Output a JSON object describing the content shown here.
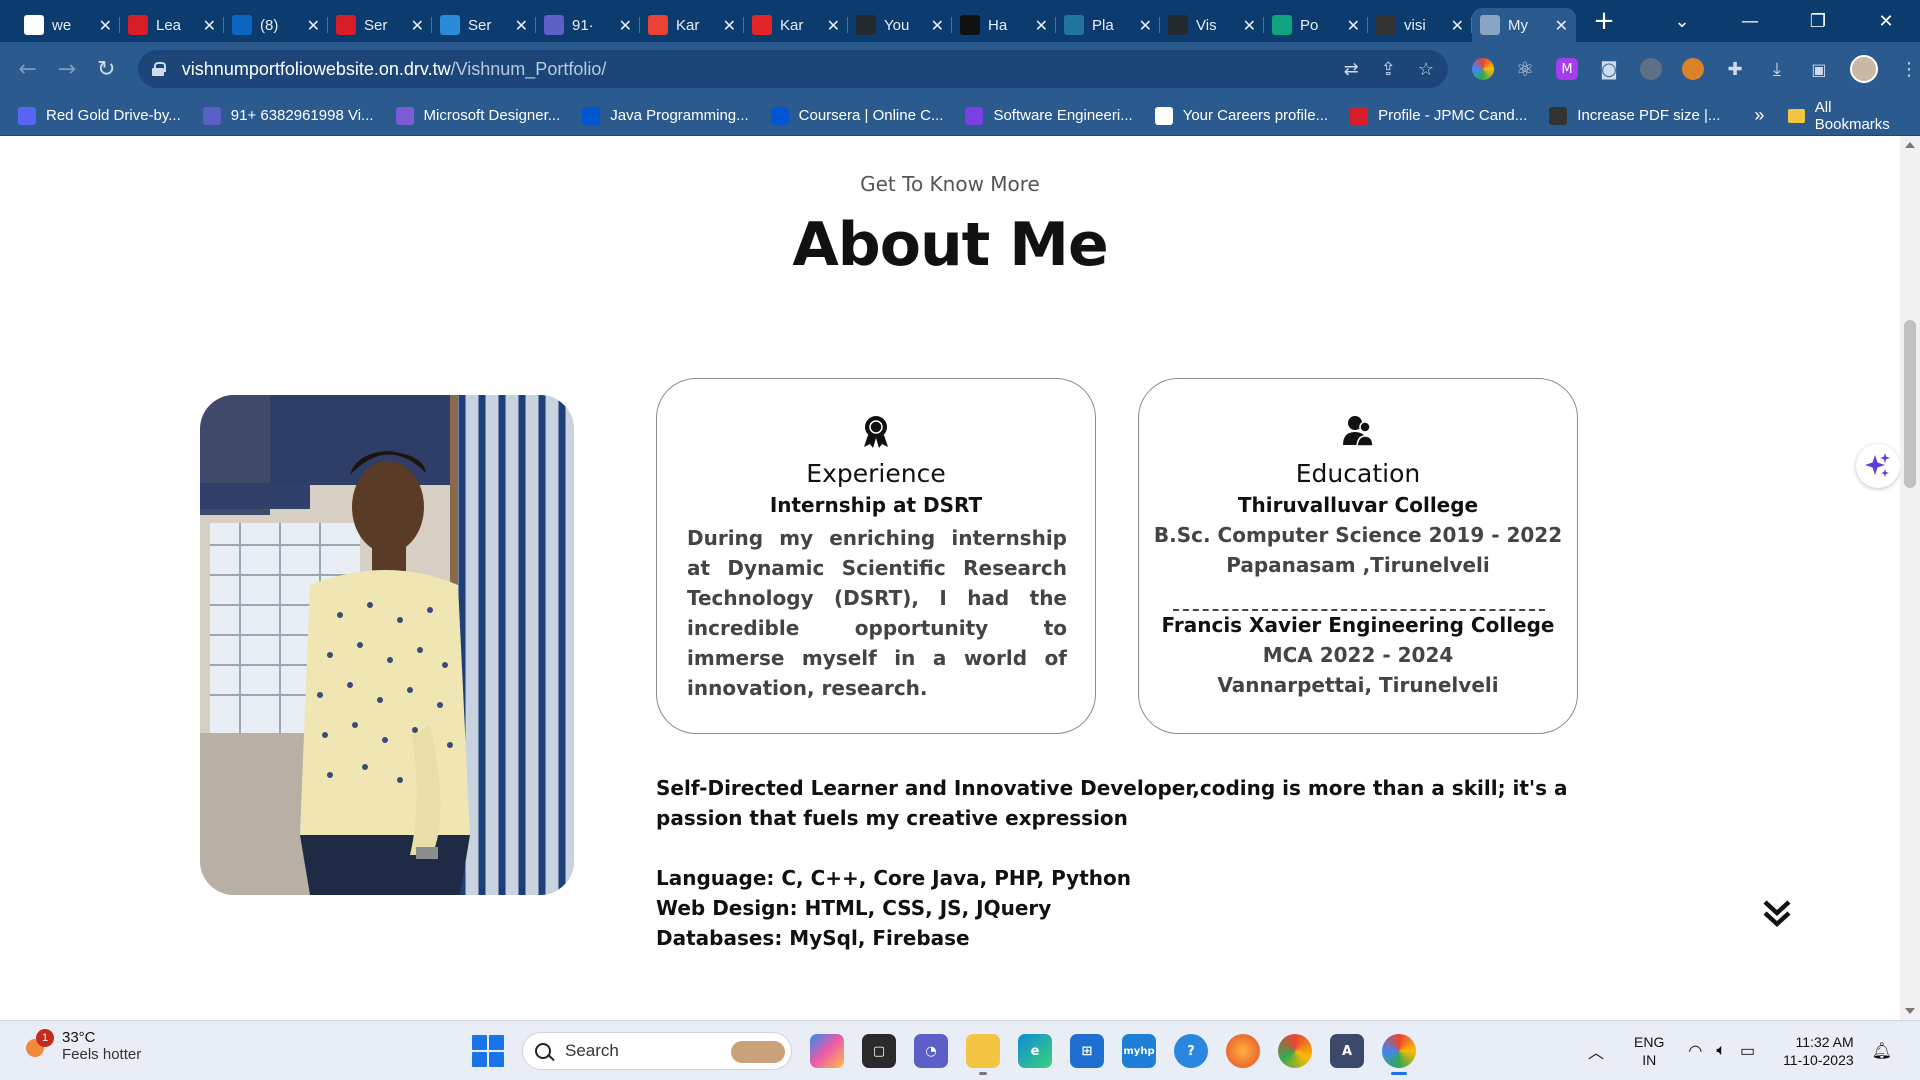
{
  "browser": {
    "tabs": [
      {
        "title": "we",
        "favicon": "google-icon",
        "color": "#ffffff"
      },
      {
        "title": "Lea",
        "favicon": "wf-icon",
        "color": "#d71e28"
      },
      {
        "title": "(8)",
        "favicon": "linkedin-icon",
        "color": "#0a66c2"
      },
      {
        "title": "Ser",
        "favicon": "wf-icon",
        "color": "#d71e28"
      },
      {
        "title": "Ser",
        "favicon": "headset-icon",
        "color": "#2a8bd8"
      },
      {
        "title": "91·",
        "favicon": "chat-icon",
        "color": "#5b5fc7"
      },
      {
        "title": "Kar",
        "favicon": "gmail-icon",
        "color": "#ea4335"
      },
      {
        "title": "Kar",
        "favicon": "zoho-icon",
        "color": "#e42527"
      },
      {
        "title": "You",
        "favicon": "github-icon",
        "color": "#24292e"
      },
      {
        "title": "Ha",
        "favicon": "hackerearth-icon",
        "color": "#111111"
      },
      {
        "title": "Pla",
        "favicon": "wordpress-icon",
        "color": "#21759b"
      },
      {
        "title": "Vis",
        "favicon": "github-icon",
        "color": "#24292e"
      },
      {
        "title": "Po",
        "favicon": "chatgpt-icon",
        "color": "#10a37f"
      },
      {
        "title": "visi",
        "favicon": "vercel-icon",
        "color": "#333333"
      },
      {
        "title": "My",
        "favicon": "globe-icon",
        "color": "#8aa4c4",
        "active": true
      }
    ],
    "url_host": "vishnumportfoliowebsite.on.drv.tw",
    "url_path": "/Vishnum_Portfolio/",
    "bookmarks": [
      {
        "label": "Red Gold Drive-by...",
        "icon": "tv-icon",
        "color": "#5865f2"
      },
      {
        "label": "91+ 6382961998 Vi...",
        "icon": "chat-icon",
        "color": "#5b5fc7"
      },
      {
        "label": "Microsoft Designer...",
        "icon": "designer-icon",
        "color": "#7b5cd6"
      },
      {
        "label": "Java Programming...",
        "icon": "coursera-icon",
        "color": "#0056d2"
      },
      {
        "label": "Coursera | Online C...",
        "icon": "coursera-icon",
        "color": "#0056d2"
      },
      {
        "label": "Software Engineeri...",
        "icon": "s-icon",
        "color": "#7b3fe4"
      },
      {
        "label": "Your Careers profile...",
        "icon": "google-icon",
        "color": "#ffffff"
      },
      {
        "label": "Profile - JPMC Cand...",
        "icon": "jpmc-icon",
        "color": "#d71e28"
      },
      {
        "label": "Increase PDF size |...",
        "icon": "pdf-icon",
        "color": "#333333"
      }
    ],
    "bookmarks_more": "»",
    "all_bookmarks": "All Bookmarks"
  },
  "page": {
    "subtitle": "Get To Know More",
    "title": "About Me",
    "experience": {
      "icon": "award-icon",
      "title": "Experience",
      "subtitle": "Internship at DSRT",
      "body": "During my enriching internship at Dynamic Scientific Research Technology (DSRT), I had the incredible opportunity to immerse myself in a world of innovation, research."
    },
    "education": {
      "icon": "users-icon",
      "title": "Education",
      "college1": "Thiruvalluvar College",
      "degree1": "B.Sc. Computer Science 2019 - 2022",
      "place1": "Papanasam ,Tirunelveli",
      "college2": "Francis Xavier Engineering College",
      "degree2": "MCA 2022 - 2024",
      "place2": "Vannarpettai, Tirunelveli"
    },
    "bio": "Self-Directed Learner and Innovative Developer,coding is more than a skill; it's a passion that fuels my creative expression",
    "skills": {
      "language": "Language: C, C++, Core Java, PHP, Python",
      "web": "Web Design: HTML, CSS, JS, JQuery",
      "db": "Databases: MySql, Firebase"
    }
  },
  "taskbar": {
    "weather_badge": "1",
    "temperature": "33°C",
    "weather_desc": "Feels hotter",
    "search_placeholder": "Search",
    "lang_line1": "ENG",
    "lang_line2": "IN",
    "time": "11:32 AM",
    "date": "11-10-2023"
  }
}
